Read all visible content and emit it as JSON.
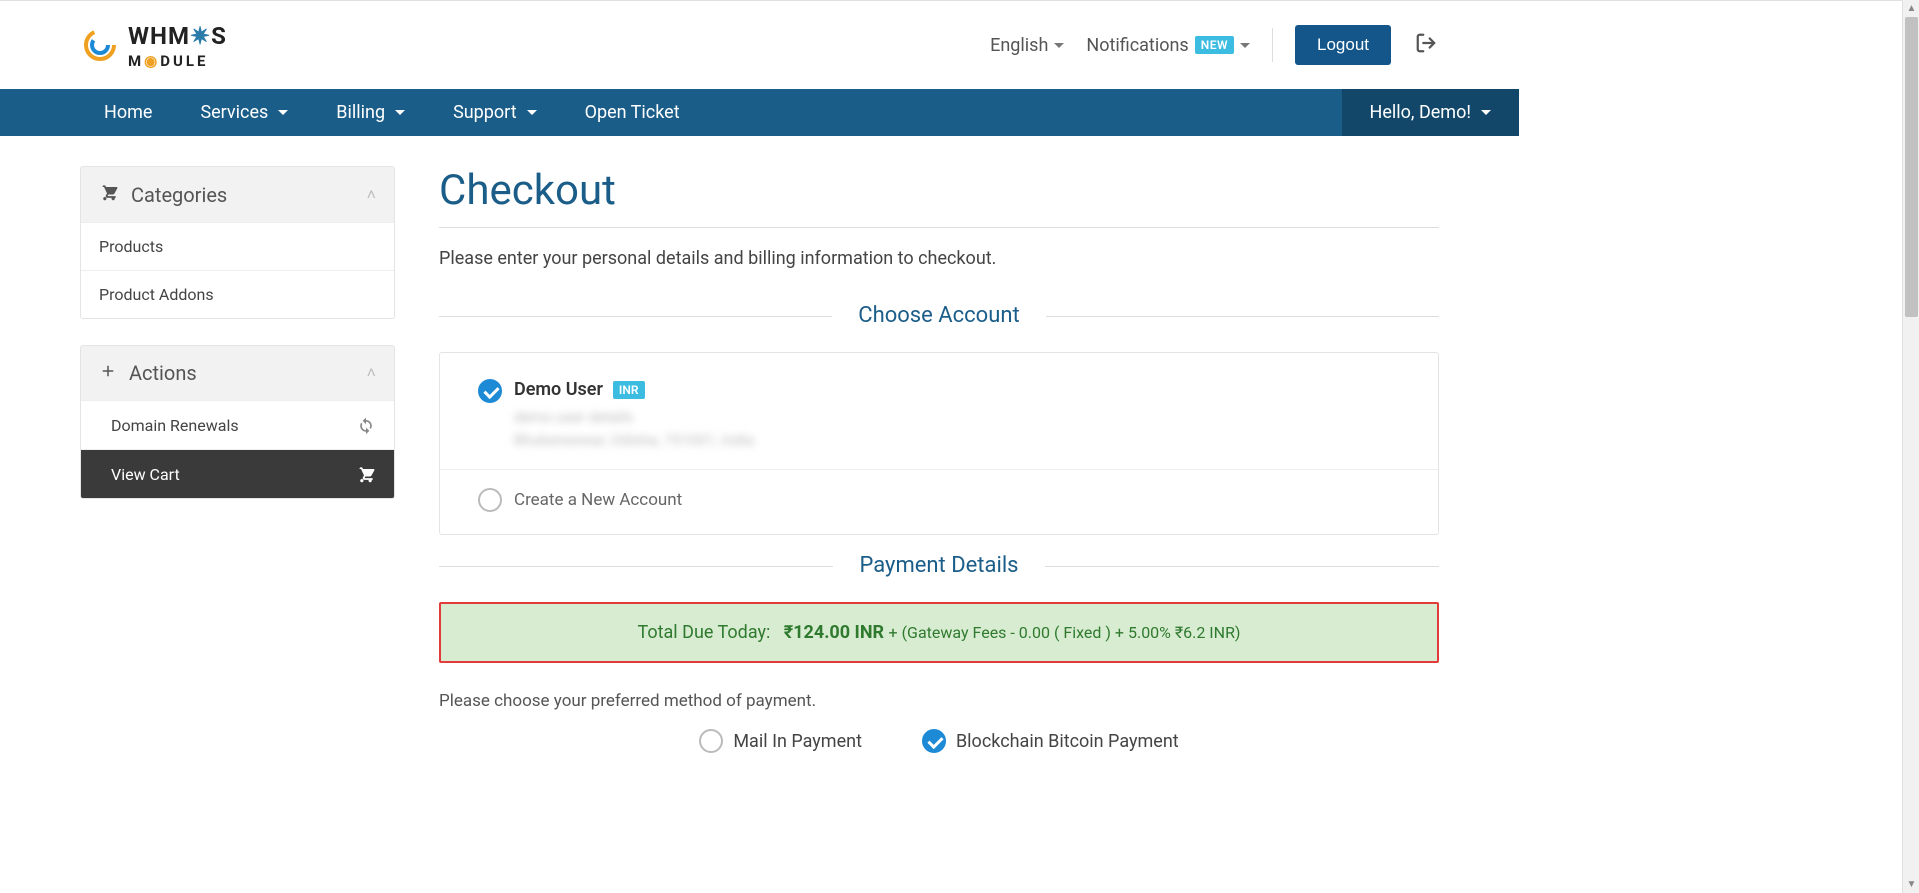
{
  "header": {
    "logo_line1": "WHM  S",
    "logo_gear_char": "C",
    "logo_line2": "M  DULE",
    "language": "English",
    "notifications_label": "Notifications",
    "notifications_badge": "NEW",
    "logout_label": "Logout"
  },
  "nav": {
    "home": "Home",
    "services": "Services",
    "billing": "Billing",
    "support": "Support",
    "open_ticket": "Open Ticket",
    "hello": "Hello, Demo!"
  },
  "sidebar": {
    "categories_title": "Categories",
    "categories": {
      "products": "Products",
      "product_addons": "Product Addons"
    },
    "actions_title": "Actions",
    "actions": {
      "domain_renewals": "Domain Renewals",
      "view_cart": "View Cart"
    }
  },
  "main": {
    "title": "Checkout",
    "intro": "Please enter your personal details and billing information to checkout.",
    "choose_account_heading": "Choose Account",
    "account": {
      "name": "Demo User",
      "currency_badge": "INR",
      "blur_line1": "demo user details",
      "blur_line2": "Bhubaneswar, Odisha, 751001, India"
    },
    "create_new_account": "Create a New Account",
    "payment_details_heading": "Payment Details",
    "total": {
      "label": "Total Due Today:",
      "amount": "₹124.00 INR",
      "fees": "+ (Gateway Fees - 0.00 ( Fixed ) + 5.00% ₹6.2 INR)"
    },
    "payment_instruction": "Please choose your preferred method of payment.",
    "pay_methods": {
      "mail": "Mail In Payment",
      "bitcoin": "Blockchain Bitcoin Payment"
    }
  }
}
